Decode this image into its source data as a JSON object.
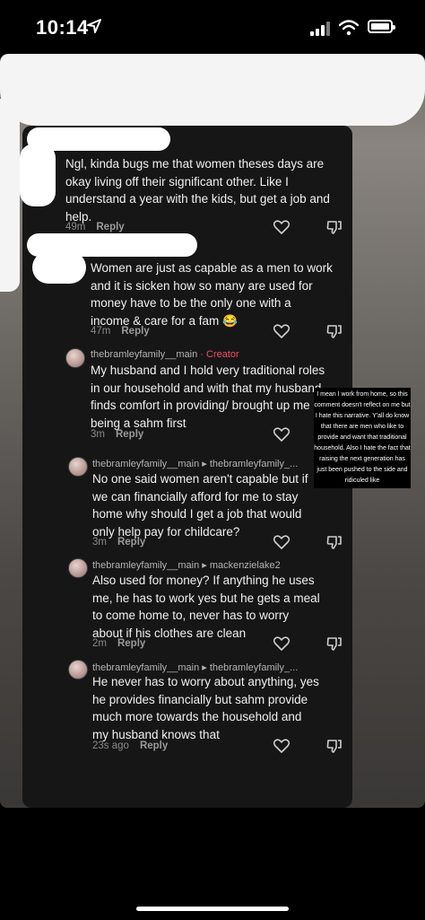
{
  "status_bar": {
    "time": "10:14"
  },
  "comments": [
    {
      "text": "Ngl, kinda bugs me that women theses days are okay living off their significant other. Like I understand a year with the kids, but get a job and help.",
      "time": "49m",
      "reply": "Reply"
    },
    {
      "text": "Women are just as capable as a men to work and it is sicken how so many are used for money have to be the only one with a income & care for a fam 😂",
      "time": "47m",
      "reply": "Reply"
    },
    {
      "username": "thebramleyfamily__main",
      "tag": " · Creator",
      "text": "My husband and I hold very traditional roles in our household and with that my husband finds comfort in providing/ brought up me being a sahm first",
      "time": "3m",
      "reply": "Reply"
    },
    {
      "username": "thebramleyfamily__main ▸ thebramleyfamily_...",
      "text": "No one said women aren't capable but if we can financially afford for me to stay home why should I get a job that would only help pay for childcare?",
      "time": "3m",
      "reply": "Reply"
    },
    {
      "username": "thebramleyfamily__main ▸ mackenzielake2",
      "text": "Also used for money? If anything he uses me, he has to work yes but he gets a meal to come home to, never has to worry about if his clothes are clean",
      "time": "2m",
      "reply": "Reply"
    },
    {
      "username": "thebramleyfamily__main ▸ thebramleyfamily_...",
      "text": "He never has to worry about anything, yes he provides financially but sahm provide much more towards the household and my husband knows that",
      "time": "23s ago",
      "reply": "Reply"
    }
  ],
  "overlay_note": "I mean I work from home, so this comment doesn't reflect on me but I hate this narrative. Y'all do know that there are men who like to provide and want that traditional household. Also I hate the fact that raising the next generation has just been pushed to the side and ridiculed like",
  "icons": [
    "location-arrow-icon",
    "signal-icon",
    "wifi-icon",
    "battery-icon",
    "heart-icon",
    "dislike-icon"
  ]
}
